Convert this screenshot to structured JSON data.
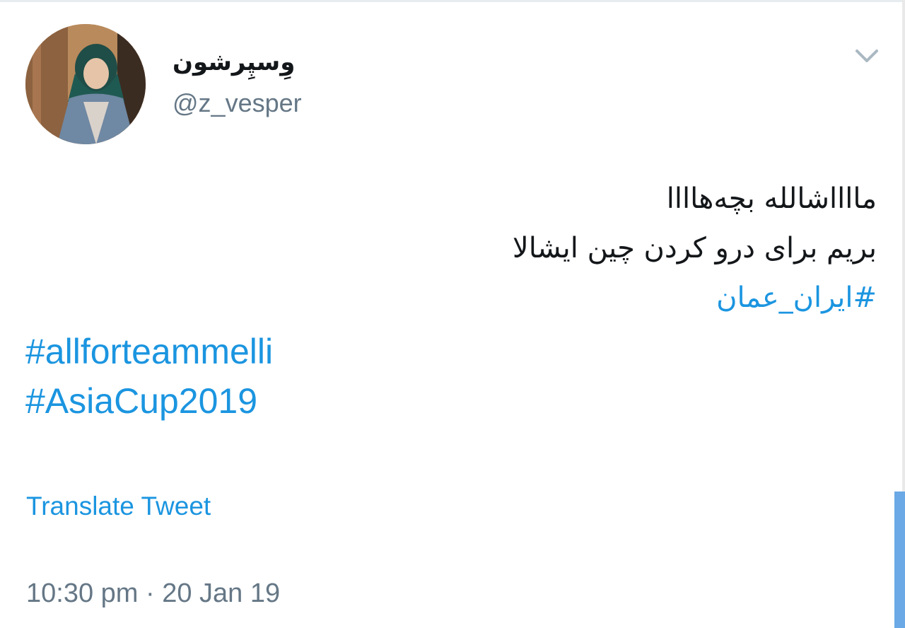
{
  "tweet": {
    "author": {
      "display_name": "وِسپِرشون",
      "handle": "@z_vesper",
      "avatar_icon": "profile-photo"
    },
    "menu_icon": "chevron-down-icon",
    "body_rtl_lines": [
      "مااااشالله بچه‌هاااا",
      "بریم برای درو کردن چین ایشالا"
    ],
    "hashtag_rtl": "#ایران_عمان",
    "hashtags_ltr": [
      "#allforteammelli",
      "#AsiaCup2019"
    ],
    "translate_label": "Translate Tweet",
    "timestamp": "10:30 pm · 20 Jan 19"
  },
  "colors": {
    "link": "#1b95e0",
    "text": "#14171a",
    "secondary": "#657786",
    "scrollbar": "#6aa8e6"
  }
}
